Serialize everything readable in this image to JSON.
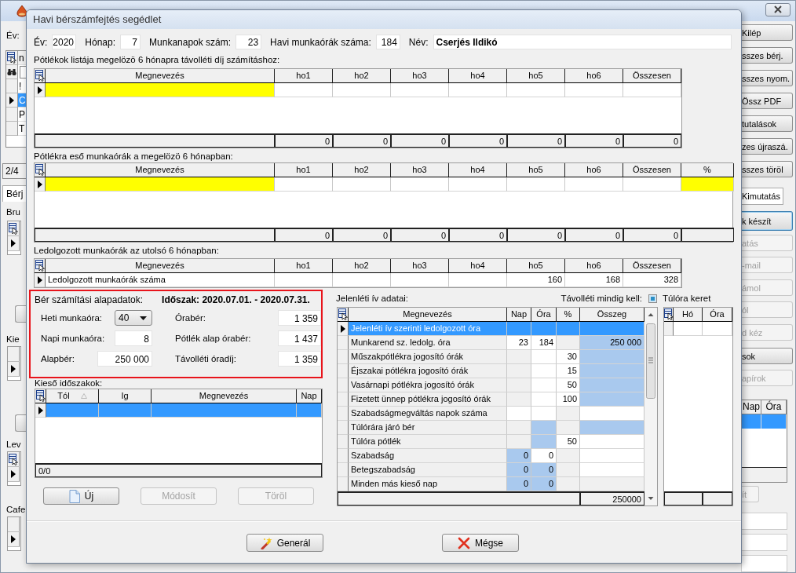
{
  "background_window": {
    "left_strip": [
      {
        "kind": "label",
        "text": "Év:"
      },
      {
        "kind": "list",
        "header": "n",
        "rows": [
          {
            "text": "!",
            "selected": false
          },
          {
            "text": "C",
            "selected": true
          },
          {
            "text": "P",
            "selected": false
          },
          {
            "text": "T",
            "selected": false
          }
        ]
      },
      {
        "kind": "pager",
        "text": "2/4"
      },
      {
        "kind": "tab",
        "text": "Bérj"
      },
      {
        "kind": "label",
        "text": "Bru"
      },
      {
        "kind": "grid",
        "menu_icon": true
      },
      {
        "kind": "button"
      },
      {
        "kind": "label",
        "text": "Kie"
      },
      {
        "kind": "grid",
        "menu_icon": false
      },
      {
        "kind": "button"
      },
      {
        "kind": "label",
        "text": "Lev"
      },
      {
        "kind": "grid",
        "menu_icon": true
      },
      {
        "kind": "label",
        "text": "Cafe"
      },
      {
        "kind": "grid",
        "menu_icon": false
      }
    ],
    "right_strip": [
      {
        "kind": "button",
        "label": "Kilép",
        "disabled": false,
        "focused": false
      },
      {
        "kind": "button",
        "label": "sszes bérj.",
        "disabled": false,
        "focused": false
      },
      {
        "kind": "button",
        "label": "sszes nyom.",
        "disabled": false,
        "focused": false
      },
      {
        "kind": "button",
        "label": "Össz PDF",
        "disabled": false,
        "focused": false
      },
      {
        "kind": "button",
        "label": "tutalások",
        "disabled": false,
        "focused": false
      },
      {
        "kind": "button",
        "label": "zes újraszá.",
        "disabled": false,
        "focused": false
      },
      {
        "kind": "button",
        "label": "sszes töröl",
        "disabled": false,
        "focused": false
      },
      {
        "kind": "tab",
        "label": "Kimutatás",
        "selected": true
      },
      {
        "kind": "button",
        "label": "k készít",
        "disabled": false,
        "focused": true
      },
      {
        "kind": "button",
        "label": "atás",
        "disabled": true,
        "focused": false
      },
      {
        "kind": "button",
        "label": "-mail",
        "disabled": true,
        "focused": false
      },
      {
        "kind": "button",
        "label": "ámol",
        "disabled": true,
        "focused": false
      },
      {
        "kind": "button",
        "label": "ól",
        "disabled": true,
        "focused": false
      },
      {
        "kind": "button",
        "label": "d kéz",
        "disabled": true,
        "focused": false
      },
      {
        "kind": "button",
        "label": "sok",
        "disabled": false,
        "focused": false
      },
      {
        "kind": "button",
        "label": "apírok",
        "disabled": true,
        "focused": false
      },
      {
        "kind": "grid",
        "columns": [
          "Nap",
          "Óra"
        ],
        "rows": [
          {
            "selected": true
          }
        ]
      },
      {
        "kind": "button",
        "label": "ít",
        "disabled": true,
        "focused": false
      },
      {
        "kind": "field"
      },
      {
        "kind": "field"
      },
      {
        "kind": "field"
      }
    ]
  },
  "dialog": {
    "title": "Havi bérszámfejtés segédlet",
    "header_fields": [
      {
        "label": "Év:",
        "value": "2020"
      },
      {
        "label": "Hónap:",
        "value": "7"
      },
      {
        "label": "Munkanapok szám:",
        "value": "23"
      },
      {
        "label": "Havi munkaórák száma:",
        "value": "184"
      },
      {
        "label": "Név:",
        "value": "Cserjés Ildikó"
      }
    ],
    "allowance_list": {
      "label": "Pótlékok listája megelözö 6 hónapra távolléti díj számításhoz:",
      "columns": [
        "Megnevezés",
        "ho1",
        "ho2",
        "ho3",
        "ho4",
        "ho5",
        "ho6",
        "Összesen"
      ],
      "rows": [
        {
          "current": true,
          "cells": [
            {
              "kind": "required"
            },
            {
              "kind": "plain"
            },
            {
              "kind": "plain"
            },
            {
              "kind": "plain"
            },
            {
              "kind": "plain"
            },
            {
              "kind": "plain"
            },
            {
              "kind": "plain"
            },
            {
              "kind": "plain"
            }
          ]
        }
      ],
      "footer": [
        "0",
        "0",
        "0",
        "0",
        "0",
        "0",
        "0"
      ]
    },
    "allowance_hours": {
      "label": "Pótlékra eső munkaórák a megelözö 6 hónapban:",
      "columns": [
        "Megnevezés",
        "ho1",
        "ho2",
        "ho3",
        "ho4",
        "ho5",
        "ho6",
        "Összesen",
        "%"
      ],
      "rows": [
        {
          "current": true,
          "cells": [
            {
              "kind": "required"
            },
            {
              "kind": "plain"
            },
            {
              "kind": "plain"
            },
            {
              "kind": "plain"
            },
            {
              "kind": "plain"
            },
            {
              "kind": "plain"
            },
            {
              "kind": "plain"
            },
            {
              "kind": "plain"
            },
            {
              "kind": "required"
            }
          ]
        }
      ],
      "footer": [
        "0",
        "0",
        "0",
        "0",
        "0",
        "0",
        "0"
      ]
    },
    "worked_hours": {
      "label": "Ledolgozott munkaórák az utolsó 6 hónapban:",
      "columns": [
        "Megnevezés",
        "ho1",
        "ho2",
        "ho3",
        "ho4",
        "ho5",
        "ho6",
        "Összesen"
      ],
      "rows": [
        {
          "current": true,
          "cells": [
            {
              "kind": "plain",
              "text": "Ledolgozott munkaórák száma"
            },
            {
              "kind": "plain"
            },
            {
              "kind": "plain"
            },
            {
              "kind": "plain"
            },
            {
              "kind": "plain"
            },
            {
              "kind": "plain",
              "text": "160"
            },
            {
              "kind": "plain",
              "text": "168"
            },
            {
              "kind": "plain",
              "text": "328"
            }
          ]
        }
      ]
    },
    "base_data": {
      "label": "Bér számítási alapadatok:",
      "period": "Időszak: 2020.07.01. - 2020.07.31.",
      "highlighted": true,
      "fields": [
        {
          "label": "Heti munkaóra:",
          "value": "40",
          "kind": "dropdown"
        },
        {
          "label": "Órabér:",
          "value": "1 359",
          "kind": "number"
        },
        {
          "label": "Napi munkaóra:",
          "value": "8",
          "kind": "number"
        },
        {
          "label": "Pótlék alap órabér:",
          "value": "1 437",
          "kind": "number"
        },
        {
          "label": "Alapbér:",
          "value": "250 000",
          "kind": "number"
        },
        {
          "label": "Távolléti óradíj:",
          "value": "1 359",
          "kind": "number"
        }
      ]
    },
    "absences": {
      "label": "Kieső időszakok:",
      "columns": [
        {
          "label": "Tól",
          "sorted": true
        },
        {
          "label": "Ig",
          "sorted": false
        },
        {
          "label": "Megnevezés",
          "sorted": false
        },
        {
          "label": "Nap",
          "sorted": false
        }
      ],
      "rows": [
        {
          "selected": true
        }
      ],
      "footer": "0/0",
      "buttons": [
        {
          "label": "Új",
          "disabled": false
        },
        {
          "label": "Módosít",
          "disabled": true
        },
        {
          "label": "Töröl",
          "disabled": true
        }
      ]
    },
    "attendance": {
      "label": "Jelenléti ív adatai:",
      "always_absence": {
        "label": "Távolléti mindig kell:",
        "checked": true
      },
      "columns": [
        "Megnevezés",
        "Nap",
        "Óra",
        "%",
        "Összeg"
      ],
      "rows": [
        {
          "selected": true,
          "cells": [
            {
              "kind": "selection",
              "text": "Jelenléti ív szerinti ledolgozott óra"
            },
            {
              "kind": "selection"
            },
            {
              "kind": "selection"
            },
            {
              "kind": "selection"
            },
            {
              "kind": "selection"
            }
          ]
        },
        {
          "selected": false,
          "cells": [
            {
              "kind": "locked",
              "text": "Munkarend sz. ledolg. óra"
            },
            {
              "kind": "plain",
              "text": "23"
            },
            {
              "kind": "plain",
              "text": "184"
            },
            {
              "kind": "locked"
            },
            {
              "kind": "calc",
              "text": "250 000"
            }
          ]
        },
        {
          "selected": false,
          "cells": [
            {
              "kind": "locked",
              "text": "Műszakpótlékra jogosító órák"
            },
            {
              "kind": "locked"
            },
            {
              "kind": "plain"
            },
            {
              "kind": "plain",
              "text": "30"
            },
            {
              "kind": "calc"
            }
          ]
        },
        {
          "selected": false,
          "cells": [
            {
              "kind": "locked",
              "text": "Éjszakai pótlékra jogosító órák"
            },
            {
              "kind": "locked"
            },
            {
              "kind": "plain"
            },
            {
              "kind": "plain",
              "text": "15"
            },
            {
              "kind": "calc"
            }
          ]
        },
        {
          "selected": false,
          "cells": [
            {
              "kind": "locked",
              "text": "Vasárnapi pótlékra jogosító órák"
            },
            {
              "kind": "locked"
            },
            {
              "kind": "plain"
            },
            {
              "kind": "plain",
              "text": "50"
            },
            {
              "kind": "calc"
            }
          ]
        },
        {
          "selected": false,
          "cells": [
            {
              "kind": "locked",
              "text": "Fizetett ünnep pótlékra jogosító órák"
            },
            {
              "kind": "locked"
            },
            {
              "kind": "plain"
            },
            {
              "kind": "plain",
              "text": "100"
            },
            {
              "kind": "calc"
            }
          ]
        },
        {
          "selected": false,
          "cells": [
            {
              "kind": "locked",
              "text": "Szabadságmegváltás napok száma"
            },
            {
              "kind": "plain"
            },
            {
              "kind": "plain"
            },
            {
              "kind": "locked"
            },
            {
              "kind": "plain"
            }
          ]
        },
        {
          "selected": false,
          "cells": [
            {
              "kind": "locked",
              "text": "Túlórára járó bér"
            },
            {
              "kind": "locked"
            },
            {
              "kind": "calc"
            },
            {
              "kind": "locked"
            },
            {
              "kind": "calc"
            }
          ]
        },
        {
          "selected": false,
          "cells": [
            {
              "kind": "locked",
              "text": "Túlóra pótlék"
            },
            {
              "kind": "locked"
            },
            {
              "kind": "calc"
            },
            {
              "kind": "plain",
              "text": "50"
            },
            {
              "kind": "plain"
            }
          ]
        },
        {
          "selected": false,
          "cells": [
            {
              "kind": "locked",
              "text": "Szabadság"
            },
            {
              "kind": "calc",
              "text": "0"
            },
            {
              "kind": "plain",
              "text": "0"
            },
            {
              "kind": "locked"
            },
            {
              "kind": "plain"
            }
          ]
        },
        {
          "selected": false,
          "cells": [
            {
              "kind": "locked",
              "text": "Betegszabadság"
            },
            {
              "kind": "calc",
              "text": "0"
            },
            {
              "kind": "calc",
              "text": "0"
            },
            {
              "kind": "locked"
            },
            {
              "kind": "plain"
            }
          ]
        },
        {
          "selected": false,
          "cells": [
            {
              "kind": "locked",
              "text": "Minden más kieső nap"
            },
            {
              "kind": "calc",
              "text": "0"
            },
            {
              "kind": "calc",
              "text": "0"
            },
            {
              "kind": "locked"
            },
            {
              "kind": "locked"
            }
          ]
        }
      ],
      "footer": "250000"
    },
    "overtime": {
      "label": "Túlóra keret",
      "columns": [
        "Hó",
        "Óra"
      ],
      "rows": [
        {
          "current": false,
          "cells": [
            {
              "kind": "plain"
            },
            {
              "kind": "plain"
            }
          ]
        }
      ]
    },
    "buttons": [
      {
        "label": "Generál"
      },
      {
        "label": "Mégse"
      }
    ]
  }
}
